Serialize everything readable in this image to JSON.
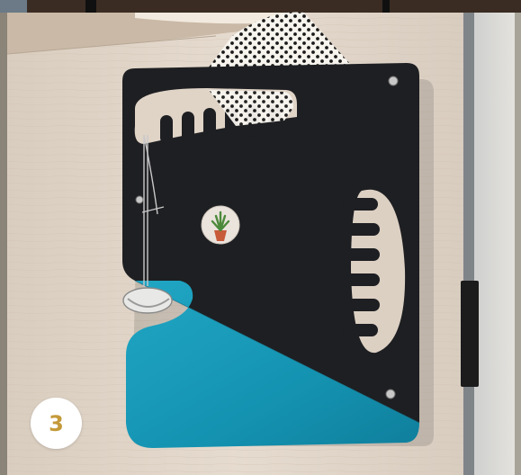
{
  "badge": {
    "number": "3"
  },
  "colors": {
    "wall_wood": "#e3d7cb",
    "panel_black": "#1e1f22",
    "panel_teal": "#1a9ab8",
    "badge_text": "#c49a3a",
    "door_frame": "#9a9ea3",
    "ceiling_light": "#f6efe4"
  },
  "scene": {
    "subject": "wall-mounted-fish-head-art-panel",
    "elements": [
      "polka-dot-fabric",
      "pendulum-wire",
      "plant-sticker",
      "door-edge",
      "door-hinge"
    ]
  }
}
